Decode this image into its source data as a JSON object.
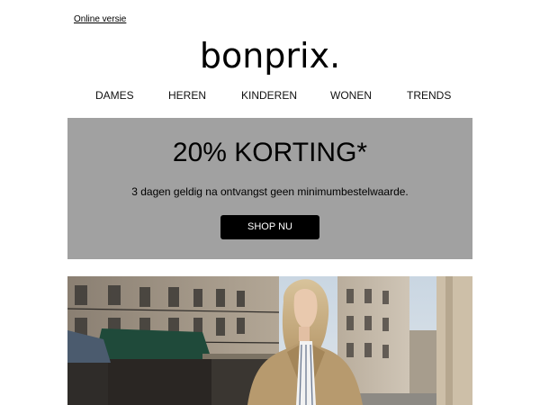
{
  "header": {
    "online_link": "Online versie",
    "logo": "bonprix."
  },
  "nav": {
    "items": [
      {
        "label": "DAMES"
      },
      {
        "label": "HEREN"
      },
      {
        "label": "KINDEREN"
      },
      {
        "label": "WONEN"
      },
      {
        "label": "TRENDS"
      }
    ]
  },
  "promo": {
    "title": "20% KORTING*",
    "text": "3 dagen geldig na ontvangst geen minimumbestelwaarde.",
    "button": "SHOP NU",
    "background": "#a1a1a1"
  }
}
